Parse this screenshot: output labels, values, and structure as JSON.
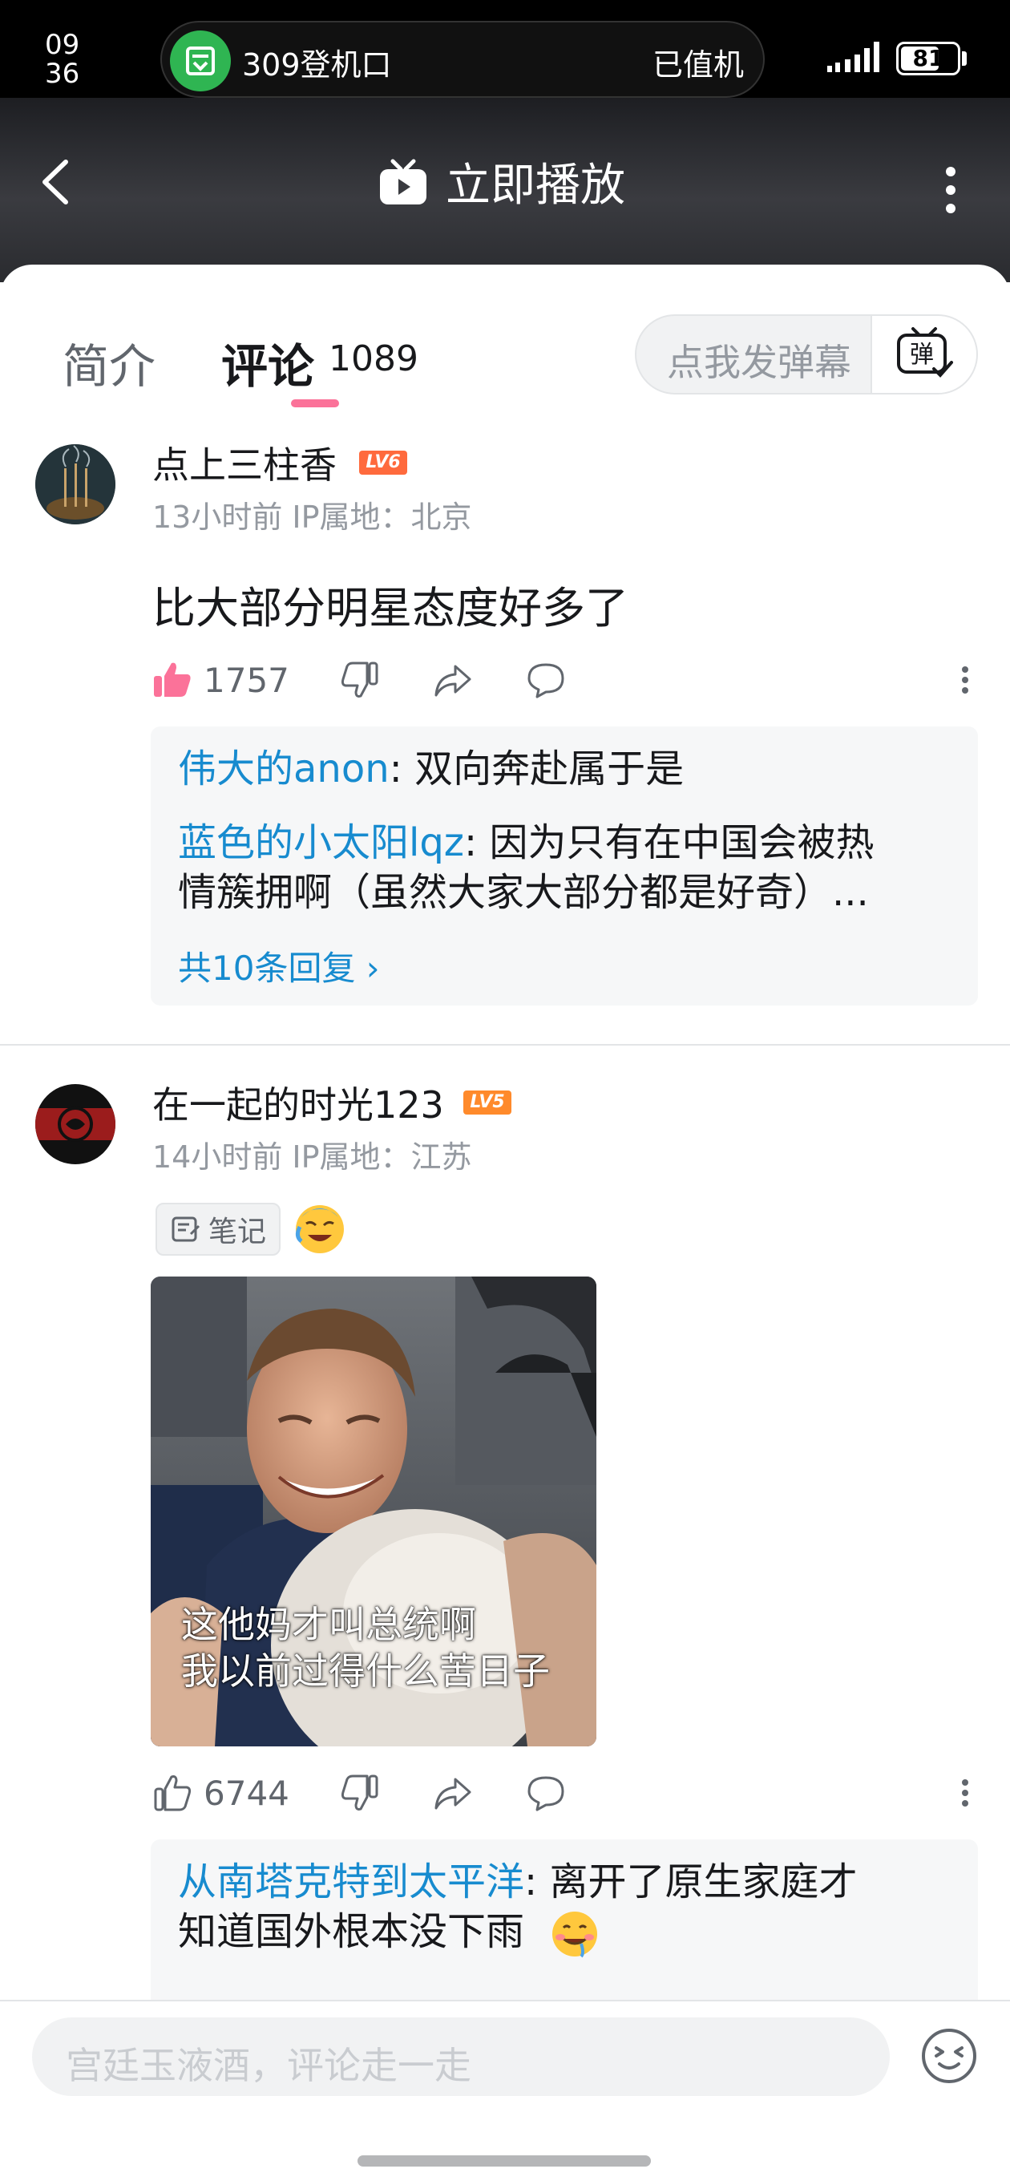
{
  "status_bar": {
    "time_hour": "09",
    "time_minute": "36",
    "pill_title": "309登机口",
    "pill_status": "已值机",
    "battery": "81"
  },
  "header": {
    "title": "立即播放"
  },
  "tabs": {
    "intro": "简介",
    "comments": "评论",
    "comment_count": "1089",
    "danmaku_placeholder": "点我发弹幕",
    "danmaku_button": "弹"
  },
  "comments": [
    {
      "username": "点上三柱香",
      "level": "LV6",
      "meta": "13小时前 IP属地：北京",
      "text": "比大部分明星态度好多了",
      "likes": "1757",
      "replies": [
        {
          "name": "伟大的anon",
          "text": ": 双向奔赴属于是"
        },
        {
          "name": "蓝色的小太阳lqz",
          "text": ": 因为只有在中国会被热",
          "text2": "情簇拥啊（虽然大家大部分都是好奇）..."
        }
      ],
      "reply_more": "共10条回复 ›"
    },
    {
      "username": "在一起的时光123",
      "level": "LV5",
      "meta": "14小时前 IP属地：江苏",
      "note_label": "笔记",
      "photo_caption_1": "这他妈才叫总统啊",
      "photo_caption_2": "我以前过得什么苦日子",
      "likes": "6744",
      "replies": [
        {
          "name": "从南塔克特到太平洋",
          "text": ": 离开了原生家庭才",
          "text2": "知道国外根本没下雨"
        }
      ]
    }
  ],
  "bottom": {
    "input_placeholder": "宫廷玉液酒，评论走一走"
  },
  "colors": {
    "accent_pink": "#fb7299",
    "link_blue": "#178bcf",
    "level6": "#ff6a3d",
    "level5": "#ff8a2b"
  }
}
